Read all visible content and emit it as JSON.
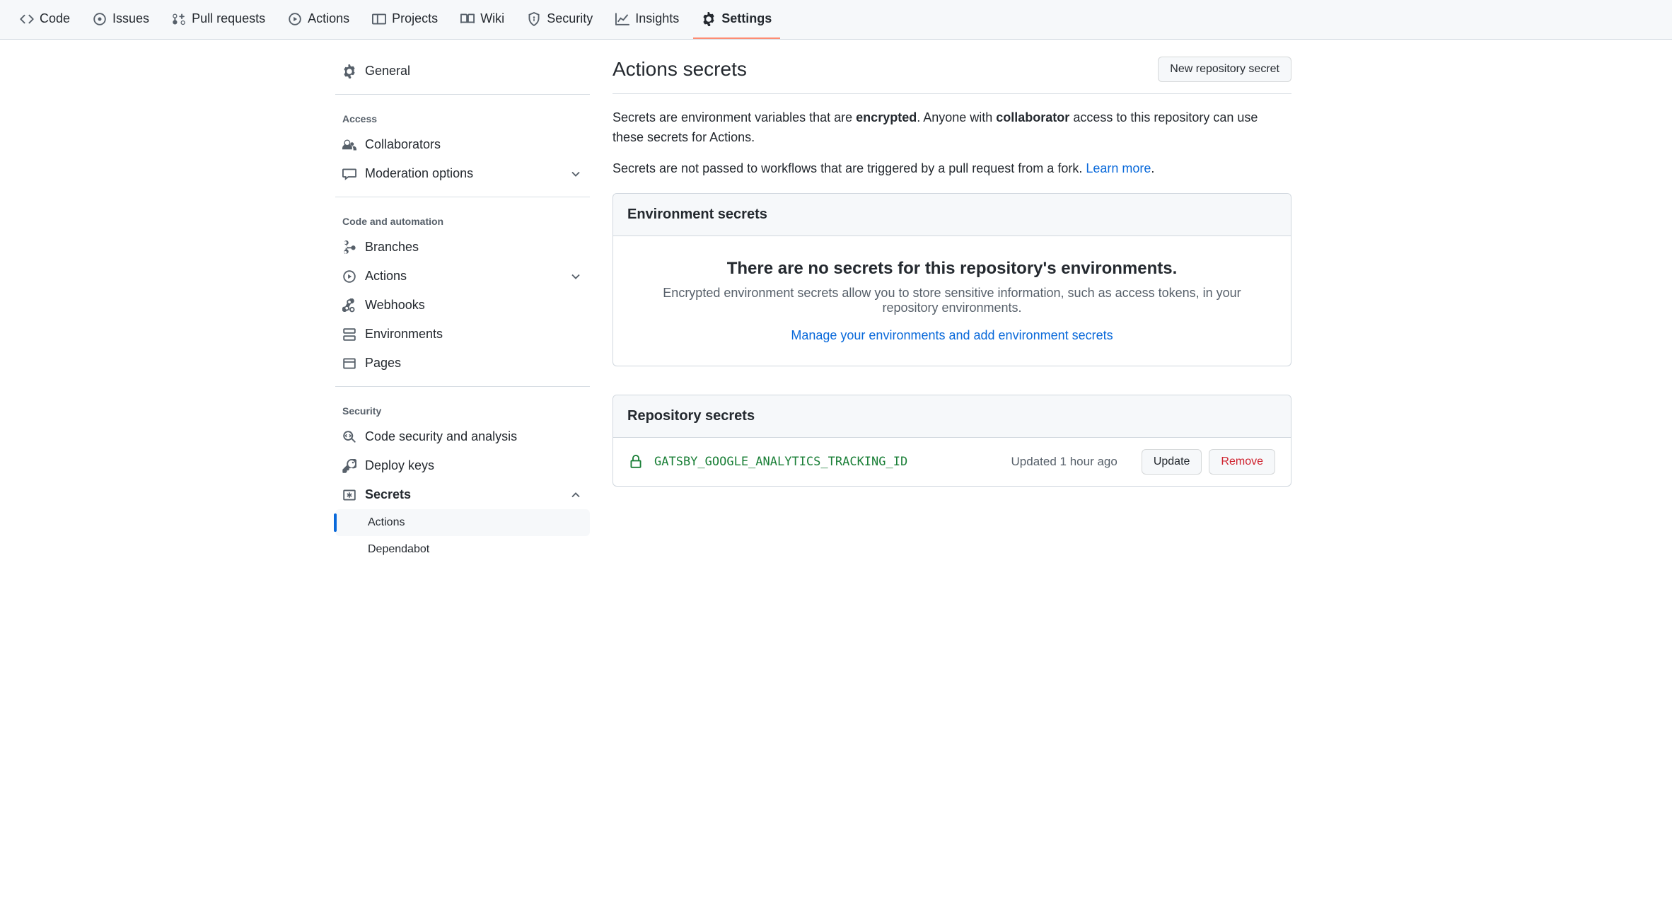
{
  "topnav": {
    "items": [
      {
        "label": "Code"
      },
      {
        "label": "Issues"
      },
      {
        "label": "Pull requests"
      },
      {
        "label": "Actions"
      },
      {
        "label": "Projects"
      },
      {
        "label": "Wiki"
      },
      {
        "label": "Security"
      },
      {
        "label": "Insights"
      },
      {
        "label": "Settings"
      }
    ]
  },
  "sidebar": {
    "general": "General",
    "groups": {
      "access": {
        "heading": "Access",
        "collaborators": "Collaborators",
        "moderation": "Moderation options"
      },
      "automation": {
        "heading": "Code and automation",
        "branches": "Branches",
        "actions": "Actions",
        "webhooks": "Webhooks",
        "environments": "Environments",
        "pages": "Pages"
      },
      "security": {
        "heading": "Security",
        "code_security": "Code security and analysis",
        "deploy_keys": "Deploy keys",
        "secrets": "Secrets",
        "secrets_sub": {
          "actions": "Actions",
          "dependabot": "Dependabot"
        }
      }
    }
  },
  "main": {
    "title": "Actions secrets",
    "new_secret_btn": "New repository secret",
    "desc1_a": "Secrets are environment variables that are ",
    "desc1_b": "encrypted",
    "desc1_c": ". Anyone with ",
    "desc1_d": "collaborator",
    "desc1_e": " access to this repository can use these secrets for Actions.",
    "desc2_a": "Secrets are not passed to workflows that are triggered by a pull request from a fork. ",
    "desc2_link": "Learn more",
    "desc2_b": ".",
    "env_panel": {
      "heading": "Environment secrets",
      "empty_title": "There are no secrets for this repository's environments.",
      "empty_text": "Encrypted environment secrets allow you to store sensitive information, such as access tokens, in your repository environments.",
      "link": "Manage your environments and add environment secrets"
    },
    "repo_panel": {
      "heading": "Repository secrets",
      "secrets": [
        {
          "name": "GATSBY_GOOGLE_ANALYTICS_TRACKING_ID",
          "updated": "Updated 1 hour ago",
          "update_btn": "Update",
          "remove_btn": "Remove"
        }
      ]
    }
  }
}
